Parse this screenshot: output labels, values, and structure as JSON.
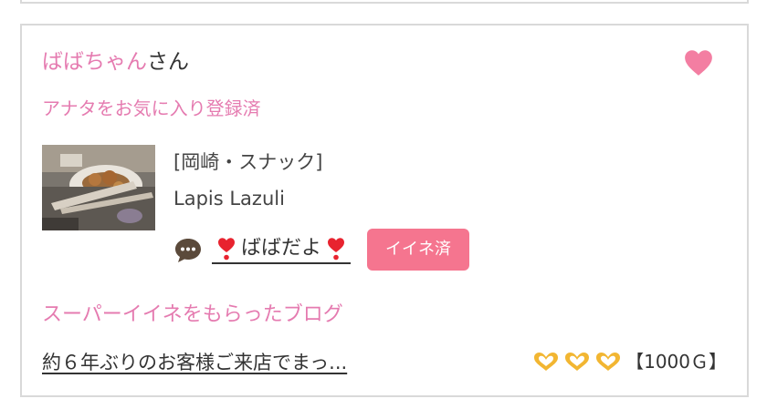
{
  "post": {
    "user_name": "ばばちゃん",
    "user_suffix": "さん",
    "favorite_status": "アナタをお気に入り登録済",
    "heart_icon": "heart-icon",
    "heart_color": "#f37ea2"
  },
  "shop": {
    "category": "[岡崎・スナック]",
    "name": "Lapis Lazuli"
  },
  "comment": {
    "icon": "speech-bubble-icon",
    "emoji_left": "❣️",
    "text": "ばばだよ",
    "emoji_right": "❣️",
    "iine_label": "イイネ済",
    "button_color": "#f5758f"
  },
  "blog": {
    "heading": "スーパーイイネをもらったブログ",
    "title": "約６年ぶりのお客様ご来店でまっ...",
    "reward_icons": [
      "heart-hands-icon",
      "heart-hands-icon",
      "heart-hands-icon"
    ],
    "reward_text": "【1000Ｇ】"
  },
  "colors": {
    "accent_pink": "#e57bb0",
    "border": "#d9d9d9"
  }
}
